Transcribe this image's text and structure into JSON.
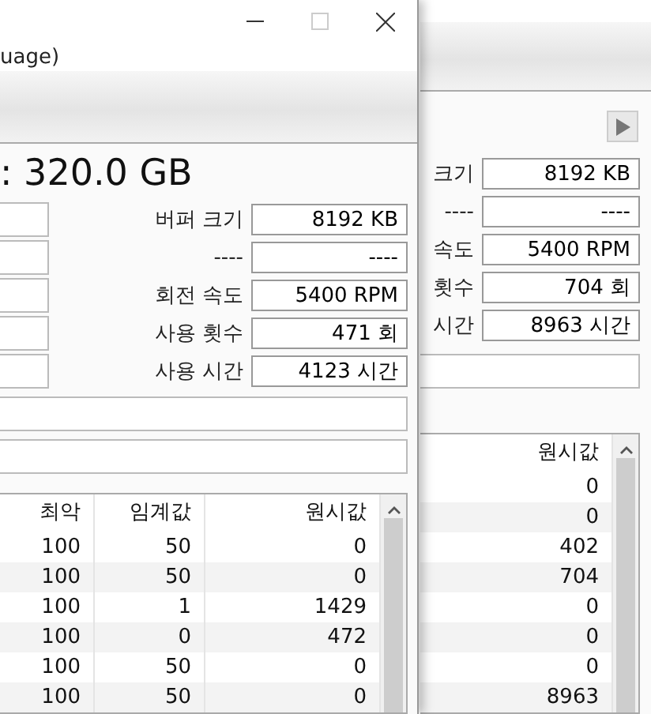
{
  "front_window": {
    "menu_text": "uage)",
    "capacity": ": 320.0 GB",
    "fields": [
      {
        "label": "버퍼 크기",
        "value": "8192 KB"
      },
      {
        "label": "----",
        "value": "----"
      },
      {
        "label": "회전 속도",
        "value": "5400 RPM"
      },
      {
        "label": "사용 횟수",
        "value": "471 회"
      },
      {
        "label": "사용 시간",
        "value": "4123 시간"
      }
    ],
    "table": {
      "columns": [
        "최악",
        "임계값",
        "원시값"
      ],
      "rows": [
        [
          "100",
          "50",
          "0"
        ],
        [
          "100",
          "50",
          "0"
        ],
        [
          "100",
          "1",
          "1429"
        ],
        [
          "100",
          "0",
          "472"
        ],
        [
          "100",
          "50",
          "0"
        ],
        [
          "100",
          "50",
          "0"
        ]
      ]
    }
  },
  "back_window": {
    "fields": [
      {
        "label": "크기",
        "value": "8192 KB"
      },
      {
        "label": "----",
        "value": "----"
      },
      {
        "label": "속도",
        "value": "5400 RPM"
      },
      {
        "label": "횟수",
        "value": "704 회"
      },
      {
        "label": "시간",
        "value": "8963 시간"
      }
    ],
    "table": {
      "columns": [
        "원시값"
      ],
      "rows": [
        [
          "0"
        ],
        [
          "0"
        ],
        [
          "402"
        ],
        [
          "704"
        ],
        [
          "0"
        ],
        [
          "0"
        ],
        [
          "0"
        ],
        [
          "8963"
        ]
      ]
    }
  }
}
